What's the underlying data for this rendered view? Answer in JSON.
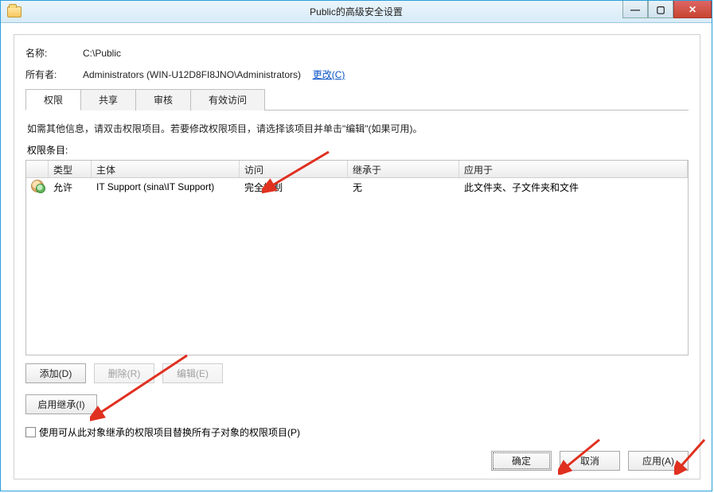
{
  "window": {
    "title": "Public的高级安全设置"
  },
  "name": {
    "label": "名称:",
    "value": "C:\\Public"
  },
  "owner": {
    "label": "所有者:",
    "value": "Administrators (WIN-U12D8FI8JNO\\Administrators)",
    "change": "更改(C)"
  },
  "tabs": {
    "permissions": "权限",
    "share": "共享",
    "audit": "审核",
    "effective": "有效访问"
  },
  "instruction": "如需其他信息，请双击权限项目。若要修改权限项目，请选择该项目并单击\"编辑\"(如果可用)。",
  "listLabel": "权限条目:",
  "headers": {
    "blank": "",
    "type": "类型",
    "principal": "主体",
    "access": "访问",
    "inheritedFrom": "继承于",
    "appliesTo": "应用于"
  },
  "rows": [
    {
      "type": "允许",
      "principal": "IT Support (sina\\IT Support)",
      "access": "完全控制",
      "inheritedFrom": "无",
      "appliesTo": "此文件夹、子文件夹和文件"
    }
  ],
  "buttons": {
    "add": "添加(D)",
    "remove": "删除(R)",
    "edit": "编辑(E)",
    "enableInherit": "启用继承(I)",
    "replaceChk": "使用可从此对象继承的权限项目替换所有子对象的权限项目(P)",
    "ok": "确定",
    "cancel": "取消",
    "apply": "应用(A)"
  }
}
